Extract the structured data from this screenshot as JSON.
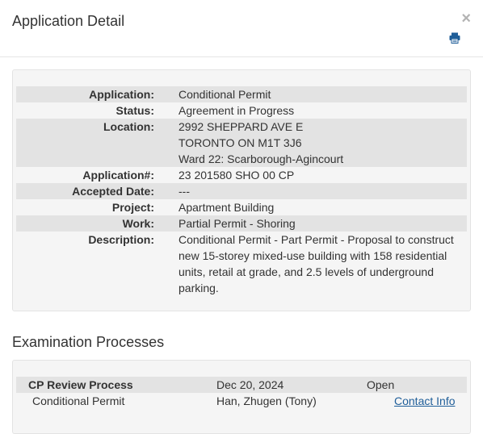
{
  "modal": {
    "title": "Application Detail",
    "close_glyph": "×",
    "print_icon": "print-icon"
  },
  "details": {
    "application": {
      "label": "Application:",
      "value": "Conditional Permit"
    },
    "status": {
      "label": "Status:",
      "value": "Agreement in Progress"
    },
    "location": {
      "label": "Location:",
      "lines": [
        "2992 SHEPPARD AVE E",
        "TORONTO ON M1T 3J6",
        "Ward 22: Scarborough-Agincourt"
      ]
    },
    "application_number": {
      "label": "Application#:",
      "value": "23 201580 SHO 00 CP"
    },
    "accepted_date": {
      "label": "Accepted Date:",
      "value": "---"
    },
    "project": {
      "label": "Project:",
      "value": "Apartment Building"
    },
    "work": {
      "label": "Work:",
      "value": "Partial Permit - Shoring"
    },
    "description": {
      "label": "Description:",
      "value": "Conditional Permit - Part Permit - Proposal to construct new 15-storey mixed-use building with 158 residential units, retail at grade, and 2.5 levels of underground parking."
    }
  },
  "examination": {
    "section_title": "Examination Processes",
    "process": {
      "name": "CP Review Process",
      "date": "Dec 20, 2024",
      "status": "Open"
    },
    "task": {
      "name": "Conditional Permit",
      "examiner": "Han, Zhugen (Tony)",
      "contact_label": "Contact Info"
    }
  }
}
